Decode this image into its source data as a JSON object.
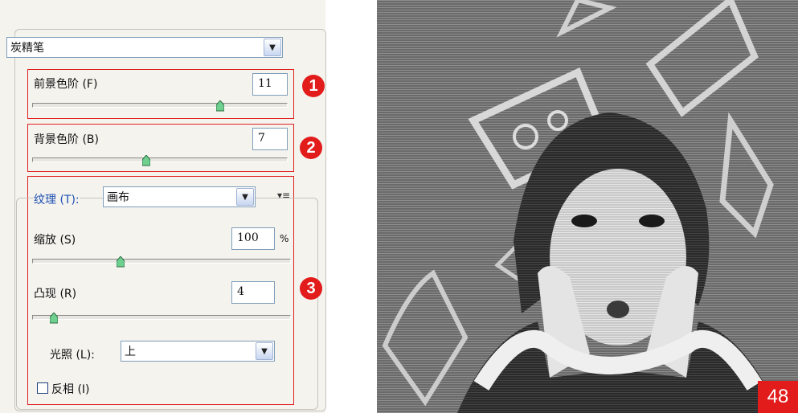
{
  "stroke_select": {
    "value": "炭精笔"
  },
  "foreground": {
    "label": "前景色阶 (F)",
    "value": "11",
    "level": 11
  },
  "background": {
    "label": "背景色阶 (B)",
    "value": "7",
    "level": 7
  },
  "texture": {
    "label": "纹理 (T):",
    "value": "画布",
    "menu_glyph": "▾≡",
    "scale": {
      "label": "缩放 (S)",
      "value": "100",
      "unit": "%",
      "level": 100
    },
    "relief": {
      "label": "凸现 (R)",
      "value": "4",
      "level": 4
    },
    "light": {
      "label": "光照 (L):",
      "value": "上"
    },
    "invert": {
      "label": "反相 (I)",
      "checked": false
    }
  },
  "badges": {
    "one": "1",
    "two": "2",
    "three": "3"
  },
  "page_number": "48",
  "colors": {
    "accent_red": "#e21b1b",
    "label_blue": "#1d4fb3",
    "panel_bg": "#f4f3ee"
  },
  "icons": {
    "dropdown": "chevron-down-icon",
    "panel_menu": "panel-menu-icon",
    "thumb": "slider-thumb-icon"
  }
}
